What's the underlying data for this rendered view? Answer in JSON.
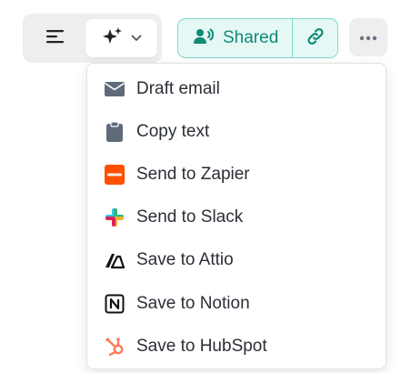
{
  "toolbar": {
    "list_icon": "align-left-icon",
    "ai_icon": "sparkles-icon",
    "ai_chevron": "chevron-down-icon",
    "shared_label": "Shared",
    "shared_icon": "users-icon",
    "link_icon": "link-icon",
    "more_icon": "more-horizontal-icon",
    "accent_color": "#0f8a78",
    "accent_bg": "#e6f8f5",
    "accent_border": "#7fd8c9"
  },
  "menu": {
    "items": [
      {
        "label": "Draft email",
        "icon": "mail-icon",
        "icon_color": "#5f6b7a"
      },
      {
        "label": "Copy text",
        "icon": "clipboard-icon",
        "icon_color": "#5f6b7a"
      },
      {
        "label": "Send to Zapier",
        "icon": "zapier-icon",
        "icon_color": "#ff4f00"
      },
      {
        "label": "Send to Slack",
        "icon": "slack-icon",
        "icon_color": "#4a154b"
      },
      {
        "label": "Save to Attio",
        "icon": "attio-icon",
        "icon_color": "#111111"
      },
      {
        "label": "Save to Notion",
        "icon": "notion-icon",
        "icon_color": "#111111"
      },
      {
        "label": "Save to HubSpot",
        "icon": "hubspot-icon",
        "icon_color": "#ff7a59"
      }
    ]
  }
}
